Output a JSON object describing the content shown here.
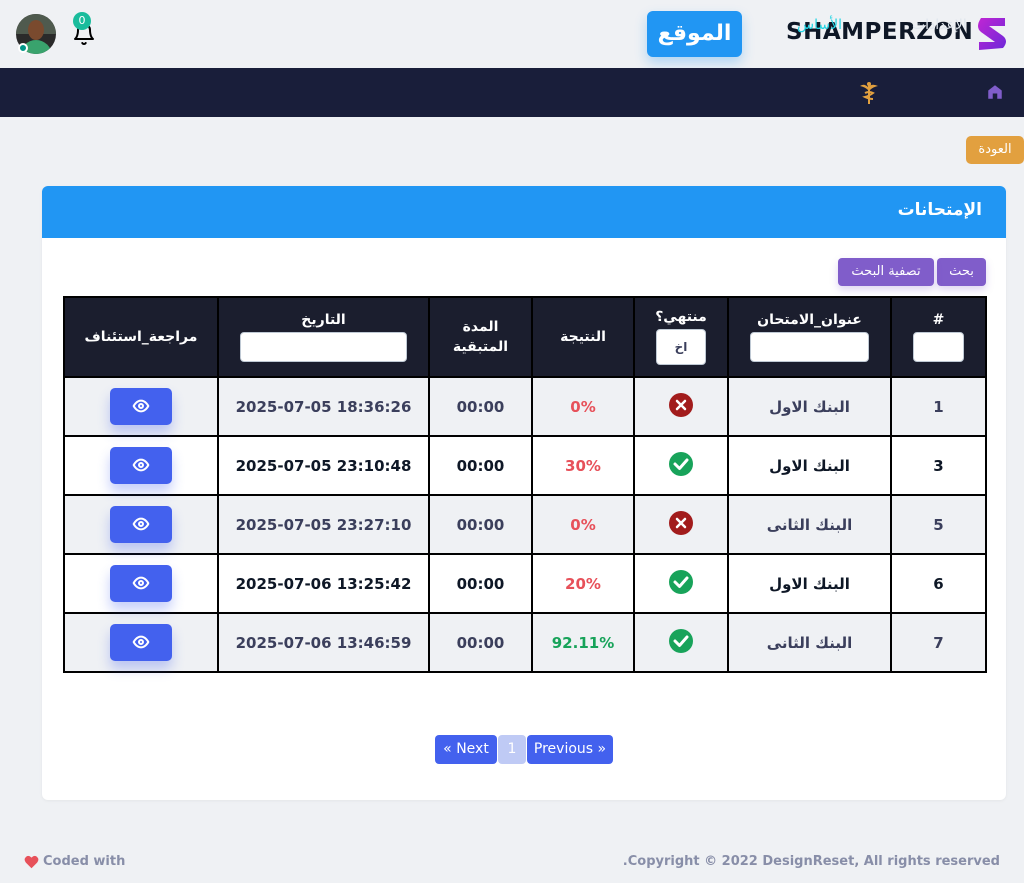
{
  "header": {
    "notification_count": "0",
    "site_button": "الموقع",
    "brand": "SHAMPERZON"
  },
  "nav": {
    "settings": "الإعدادات",
    "base": "الأساس"
  },
  "back_button": "العودة",
  "card": {
    "title": "الإمتحانات",
    "search_button": "بحث",
    "filter_button": "تصفية البحث"
  },
  "table": {
    "columns": {
      "num": "#",
      "title": "عنوان_الامتحان",
      "finished": "منتهي؟",
      "finished_select": "اخ",
      "result": "النتيجة",
      "remaining": "المدة المتبقية",
      "date": "التاريخ",
      "review": "مراجعة_استئناف"
    },
    "rows": [
      {
        "num": "1",
        "title": "البنك الاول",
        "finished": false,
        "result": "0%",
        "remaining": "00:00",
        "date": "2025-07-05 18:36:26"
      },
      {
        "num": "3",
        "title": "البنك الاول",
        "finished": true,
        "result": "30%",
        "remaining": "00:00",
        "date": "2025-07-05 23:10:48"
      },
      {
        "num": "5",
        "title": "البنك الثانى",
        "finished": false,
        "result": "0%",
        "remaining": "00:00",
        "date": "2025-07-05 23:27:10"
      },
      {
        "num": "6",
        "title": "البنك الاول",
        "finished": true,
        "result": "20%",
        "remaining": "00:00",
        "date": "2025-07-06 13:25:42"
      },
      {
        "num": "7",
        "title": "البنك الثانى",
        "finished": true,
        "result": "92.11%",
        "remaining": "00:00",
        "date": "2025-07-06 13:46:59"
      }
    ]
  },
  "pagination": {
    "next": "« Next",
    "current": "1",
    "previous": "Previous »"
  },
  "footer": {
    "left": "Coded with",
    "right": "Copyright © 2022 DesignReset, All rights reserved."
  },
  "colors": {
    "primary": "#2196f3",
    "navbar": "#191e3a",
    "accent_purple": "#805dca",
    "view_button": "#4361ee",
    "warning": "#e2a03f"
  }
}
